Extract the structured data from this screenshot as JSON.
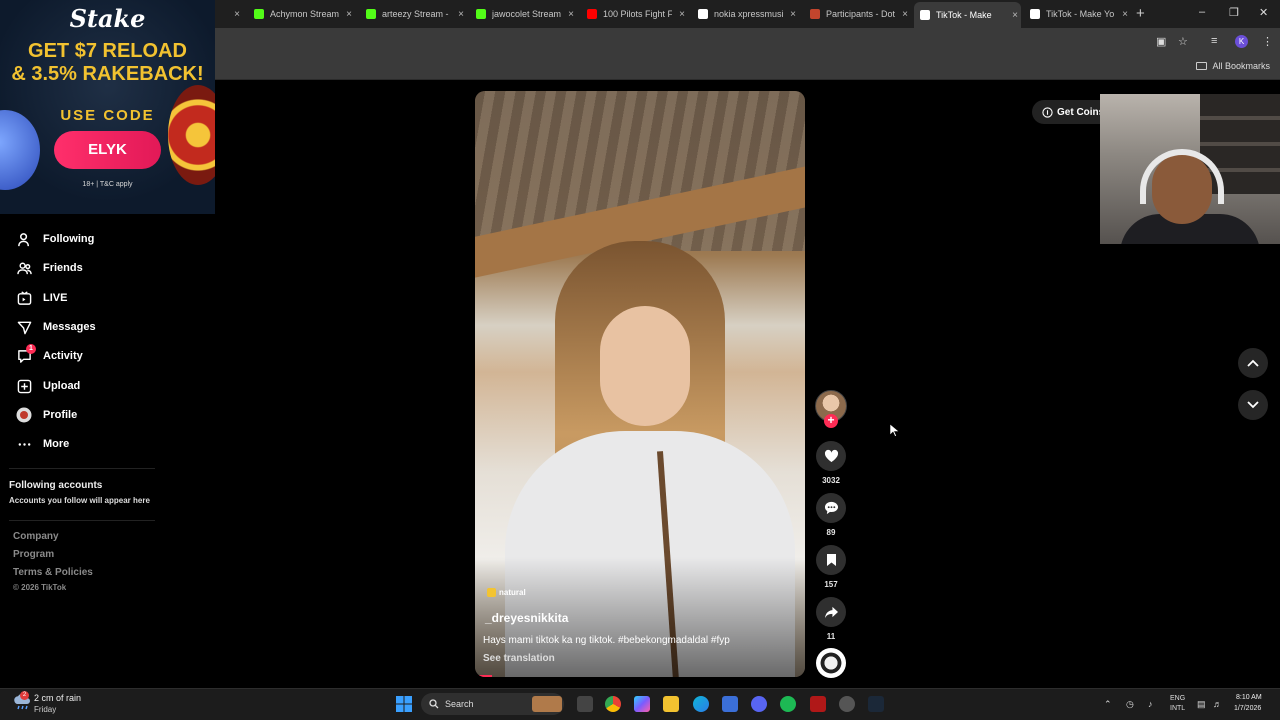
{
  "browser": {
    "tabs": [
      {
        "title": "",
        "color": "#53fc18"
      },
      {
        "title": "Achymon Stream - ",
        "color": "#53fc18"
      },
      {
        "title": "arteezy Stream - V",
        "color": "#53fc18"
      },
      {
        "title": "jawocolet Stream",
        "color": "#53fc18"
      },
      {
        "title": "100 Pilots Fight F",
        "color": "#ff0000"
      },
      {
        "title": "nokia xpressmusic",
        "color": "#ffffff"
      },
      {
        "title": "Participants - Dot",
        "color": "#c2452d"
      },
      {
        "title": "TikTok - Make",
        "color": "#ffffff"
      },
      {
        "title": "TikTok - Make Yo",
        "color": "#ffffff"
      }
    ],
    "profile_initial": "K",
    "all_bookmarks": "All Bookmarks",
    "new_tab": "+",
    "close_char": "×"
  },
  "ad": {
    "brand": "Stake",
    "headline1": "GET $7 RELOAD",
    "headline2": "& 3.5% RAKEBACK!",
    "use_code": "USE CODE",
    "code": "ELYK",
    "terms": "18+ | T&C apply"
  },
  "sidebar": {
    "items": [
      {
        "label": "Following",
        "icon": "following-icon"
      },
      {
        "label": "Friends",
        "icon": "friends-icon"
      },
      {
        "label": "LIVE",
        "icon": "live-icon"
      },
      {
        "label": "Messages",
        "icon": "messages-icon"
      },
      {
        "label": "Activity",
        "icon": "activity-icon",
        "badge": "1"
      },
      {
        "label": "Upload",
        "icon": "upload-icon"
      },
      {
        "label": "Profile",
        "icon": "profile-icon"
      },
      {
        "label": "More",
        "icon": "more-icon"
      }
    ],
    "following_accounts_title": "Following accounts",
    "following_accounts_sub": "Accounts you follow will appear here",
    "footer": [
      "Company",
      "Program",
      "Terms & Policies",
      "© 2026 TikTok"
    ]
  },
  "video": {
    "tag": "natural",
    "username": "_dreyesnikkita",
    "caption": "Hays mami tiktok ka ng tiktok. #bebekongmadaldal #fyp",
    "see_translation": "See translation",
    "progress": 0.05
  },
  "actions": {
    "likes": "3032",
    "comments": "89",
    "saves": "157",
    "shares": "11",
    "follow_plus": "+"
  },
  "right": {
    "get_coins": "Get Coins"
  },
  "taskbar": {
    "weather_temp": "2 cm of rain",
    "weather_day": "Friday",
    "weather_badge": "2",
    "search": "Search",
    "lang1": "ENG",
    "lang2": "INTL",
    "time": "8:10 AM",
    "date": "1/7/2026"
  },
  "colors": {
    "accent": "#fe2c55",
    "stake_gold": "#f2c230",
    "background": "#000000"
  }
}
